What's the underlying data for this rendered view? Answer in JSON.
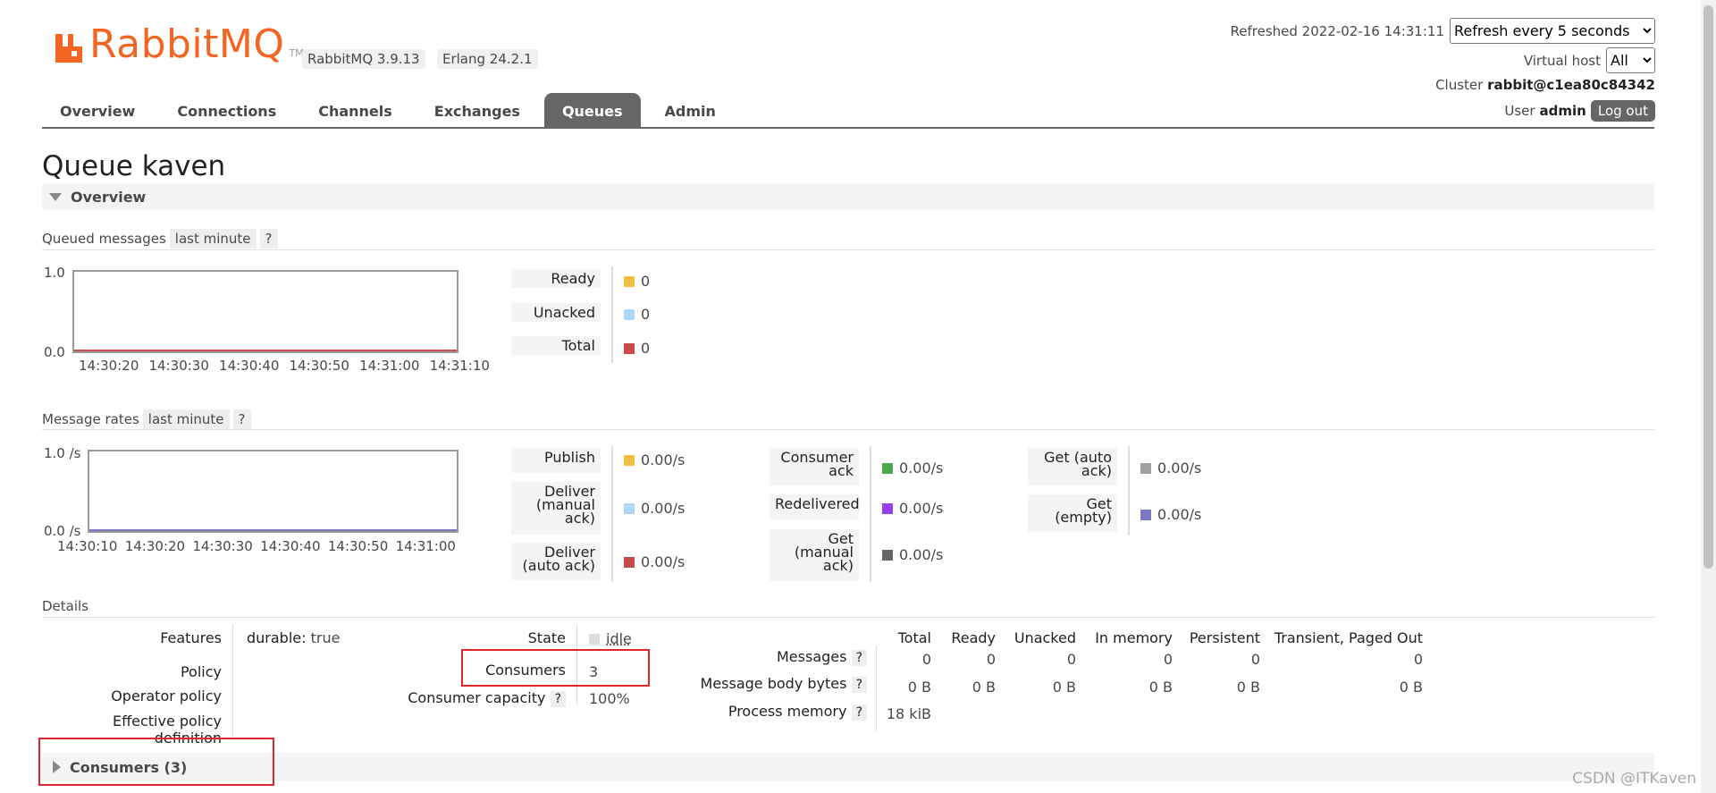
{
  "brand": {
    "name": "RabbitMQ",
    "tm": "TM",
    "version": "RabbitMQ 3.9.13",
    "erlang": "Erlang 24.2.1",
    "color": "#f26522"
  },
  "header": {
    "refreshed": "Refreshed 2022-02-16 14:31:11",
    "refresh_select": "Refresh every 5 seconds",
    "vhost_label": "Virtual host",
    "vhost_value": "All",
    "cluster_label": "Cluster",
    "cluster_value": "rabbit@c1ea80c84342",
    "user_label": "User",
    "user_value": "admin",
    "logout": "Log out"
  },
  "nav": {
    "tabs": [
      "Overview",
      "Connections",
      "Channels",
      "Exchanges",
      "Queues",
      "Admin"
    ],
    "active": "Queues"
  },
  "page_title": "Queue kaven",
  "overview": {
    "title": "Overview",
    "queued": {
      "label": "Queued messages",
      "range": "last minute",
      "help": "?",
      "y_top": "1.0",
      "y_bottom": "0.0",
      "x_ticks": [
        "14:30:20",
        "14:30:30",
        "14:30:40",
        "14:30:50",
        "14:31:00",
        "14:31:10"
      ],
      "stats": [
        {
          "label": "Ready",
          "value": "0",
          "color": "#edc240"
        },
        {
          "label": "Unacked",
          "value": "0",
          "color": "#afd8f8"
        },
        {
          "label": "Total",
          "value": "0",
          "color": "#cb4b4b"
        }
      ]
    },
    "rates": {
      "label": "Message rates",
      "range": "last minute",
      "help": "?",
      "y_top": "1.0 /s",
      "y_bottom": "0.0 /s",
      "x_ticks": [
        "14:30:10",
        "14:30:20",
        "14:30:30",
        "14:30:40",
        "14:30:50",
        "14:31:00"
      ],
      "col1": [
        {
          "label": "Publish",
          "value": "0.00/s",
          "color": "#edc240"
        },
        {
          "label": "Deliver (manual ack)",
          "value": "0.00/s",
          "color": "#afd8f8"
        },
        {
          "label": "Deliver (auto ack)",
          "value": "0.00/s",
          "color": "#cb4b4b"
        }
      ],
      "col2": [
        {
          "label": "Consumer ack",
          "value": "0.00/s",
          "color": "#4da74d"
        },
        {
          "label": "Redelivered",
          "value": "0.00/s",
          "color": "#9440ed"
        },
        {
          "label": "Get (manual ack)",
          "value": "0.00/s",
          "color": "#666666"
        }
      ],
      "col3": [
        {
          "label": "Get (auto ack)",
          "value": "0.00/s",
          "color": "#a0a0a0"
        },
        {
          "label": "Get (empty)",
          "value": "0.00/s",
          "color": "#7c79c3"
        }
      ]
    }
  },
  "details": {
    "label": "Details",
    "features_label": "Features",
    "features_key": "durable:",
    "features_value": "true",
    "policy_label": "Policy",
    "operator_policy_label": "Operator policy",
    "effective_policy_label": "Effective policy definition",
    "state_label": "State",
    "state_value": "idle",
    "consumers_label": "Consumers",
    "consumers_value": "3",
    "capacity_label": "Consumer capacity",
    "capacity_help": "?",
    "capacity_value": "100%",
    "table": {
      "headers": [
        "Total",
        "Ready",
        "Unacked",
        "In memory",
        "Persistent",
        "Transient, Paged Out"
      ],
      "rows": [
        {
          "label": "Messages",
          "values": [
            "0",
            "0",
            "0",
            "0",
            "0",
            "0"
          ]
        },
        {
          "label": "Message body bytes",
          "values": [
            "0 B",
            "0 B",
            "0 B",
            "0 B",
            "0 B",
            "0 B"
          ]
        },
        {
          "label": "Process memory",
          "values": [
            "18 kiB"
          ]
        }
      ],
      "help": "?"
    }
  },
  "consumers_section": {
    "title": "Consumers (3)"
  },
  "watermark": "CSDN @ITKaven"
}
